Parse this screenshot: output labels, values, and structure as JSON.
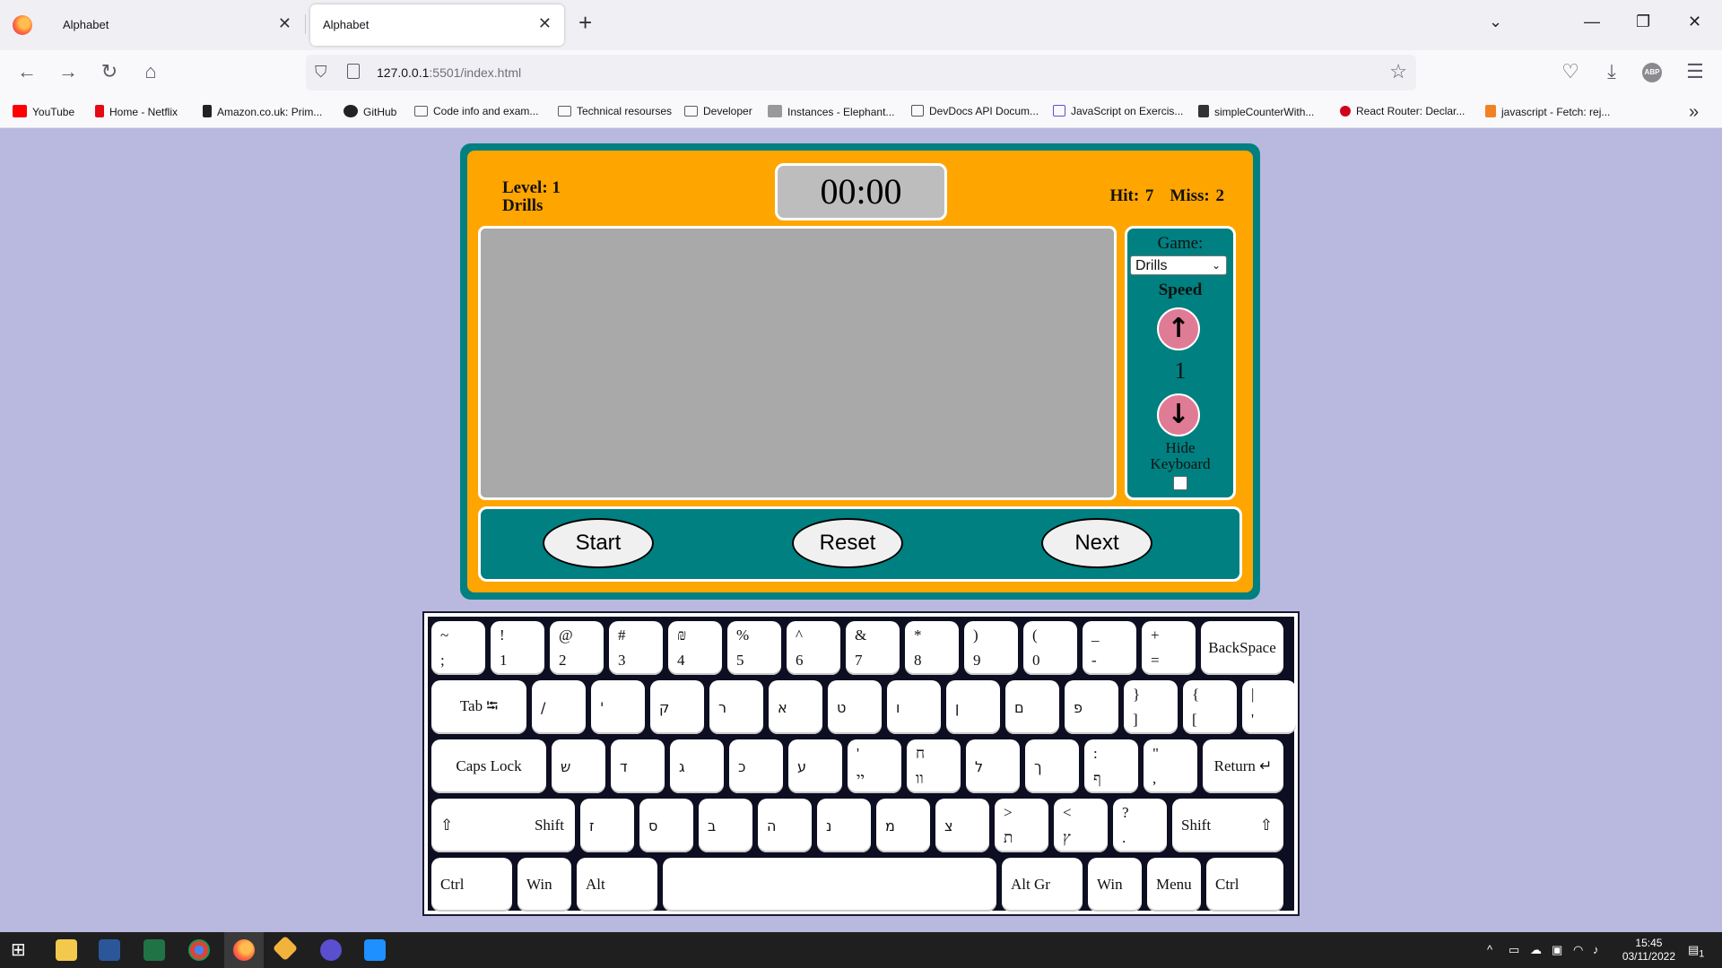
{
  "browser": {
    "tabs": [
      {
        "title": "Alphabet",
        "close": "✕"
      },
      {
        "title": "Alphabet",
        "close": "✕"
      }
    ],
    "new_tab": "+",
    "url_host": "127.0.0.1",
    "url_rest": ":5501/index.html",
    "bookmarks": [
      "YouTube",
      "Home - Netflix",
      "Amazon.co.uk: Prim...",
      "GitHub",
      "Code info and exam...",
      "Technical resourses",
      "Developer",
      "Instances - Elephant...",
      "DevDocs API Docum...",
      "JavaScript on Exercis...",
      "simpleCounterWith...",
      "React Router: Declar...",
      "javascript - Fetch: rej..."
    ],
    "abp": "ABP"
  },
  "game": {
    "level": "Level: 1",
    "mode": "Drills",
    "timer": "00:00",
    "hit": "Hit: 7",
    "miss": "Miss: 2",
    "game_label": "Game:",
    "game_select": "Drills",
    "speed_label": "Speed",
    "speed_value": "1",
    "hide_keyboard_1": "Hide",
    "hide_keyboard_2": "Keyboard",
    "buttons": {
      "start": "Start",
      "reset": "Reset",
      "next": "Next"
    }
  },
  "keyboard": {
    "row1": [
      {
        "top": "~",
        "bot": ";"
      },
      {
        "top": "!",
        "bot": "1"
      },
      {
        "top": "@",
        "bot": "2"
      },
      {
        "top": "#",
        "bot": "3"
      },
      {
        "top": "₪",
        "bot": "4"
      },
      {
        "top": "%",
        "bot": "5"
      },
      {
        "top": "^",
        "bot": "6"
      },
      {
        "top": "&",
        "bot": "7"
      },
      {
        "top": "*",
        "bot": "8"
      },
      {
        "top": ")",
        "bot": "9"
      },
      {
        "top": "(",
        "bot": "0"
      },
      {
        "top": "_",
        "bot": "-"
      },
      {
        "top": "+",
        "bot": "="
      }
    ],
    "backspace": "BackSpace",
    "tab": "Tab ⭾",
    "row2": [
      "/",
      "'",
      "ק",
      "ר",
      "א",
      "ט",
      "ו",
      "ן",
      "ם",
      "פ"
    ],
    "row2_pairs": [
      {
        "top": "}",
        "bot": "]"
      },
      {
        "top": "{",
        "bot": "["
      },
      {
        "top": "|",
        "bot": "'"
      }
    ],
    "caps": "Caps Lock",
    "row3": [
      "ש",
      "ד",
      "ג",
      "כ",
      "ע"
    ],
    "row3_pairs": [
      {
        "top": "'",
        "bot": "יי"
      },
      {
        "top": "ח",
        "bot": "וו"
      }
    ],
    "row3b": [
      "ל",
      "ך"
    ],
    "row3_pairs2": [
      {
        "top": ":",
        "bot": "ף"
      },
      {
        "top": "\"",
        "bot": ","
      }
    ],
    "return": "Return ↵",
    "shift": "Shift",
    "shift_arrow": "⇧",
    "row4": [
      "ז",
      "ס",
      "ב",
      "ה",
      "נ",
      "מ",
      "צ"
    ],
    "row4_pairs": [
      {
        "top": ">",
        "bot": "ת"
      },
      {
        "top": "<",
        "bot": "ץ"
      },
      {
        "top": "?",
        "bot": "."
      }
    ],
    "bottom": {
      "ctrl": "Ctrl",
      "win": "Win",
      "alt": "Alt",
      "altgr": "Alt Gr",
      "menu": "Menu"
    }
  },
  "taskbar": {
    "time": "15:45",
    "date": "03/11/2022",
    "notif": "1"
  }
}
